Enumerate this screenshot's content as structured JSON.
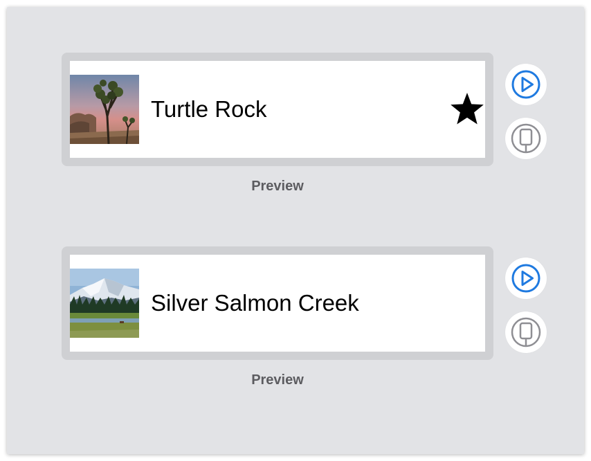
{
  "previews": [
    {
      "landmark_name": "Turtle Rock",
      "is_favorite": true,
      "favorite_icon": "star-filled-icon",
      "thumbnail": "joshua-tree-photo",
      "preview_label": "Preview",
      "live_preview_icon": "play-circle-icon",
      "device_preview_icon": "device-circle-icon"
    },
    {
      "landmark_name": "Silver Salmon Creek",
      "is_favorite": false,
      "thumbnail": "mountain-meadow-photo",
      "preview_label": "Preview",
      "live_preview_icon": "play-circle-icon",
      "device_preview_icon": "device-circle-icon"
    }
  ],
  "colors": {
    "canvas_background": "#e2e3e6",
    "frame_border": "#cfd0d3",
    "accent_blue": "#1f7ae0",
    "device_gray": "#8e8e93",
    "label_gray": "#5c5c60"
  }
}
